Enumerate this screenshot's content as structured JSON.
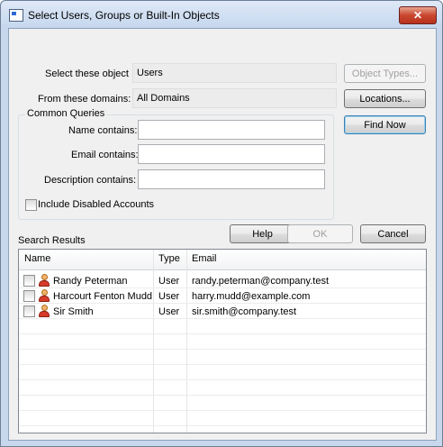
{
  "window": {
    "title": "Select Users, Groups or Built-In Objects",
    "close_glyph": "✕"
  },
  "object_type": {
    "label": "Select these object",
    "value": "Users",
    "button": "Object Types..."
  },
  "domains": {
    "label": "From these domains:",
    "value": "All Domains",
    "button": "Locations..."
  },
  "common_queries": {
    "title": "Common Queries",
    "name_label": "Name contains:",
    "name_value": "",
    "email_label": "Email contains:",
    "email_value": "",
    "description_label": "Description contains:",
    "description_value": "",
    "include_disabled_label": "Include Disabled Accounts",
    "include_disabled_checked": false
  },
  "buttons": {
    "find_now": "Find Now",
    "help": "Help",
    "ok": "OK",
    "cancel": "Cancel"
  },
  "results": {
    "label": "Search Results",
    "columns": [
      "Name",
      "Type",
      "Email"
    ],
    "rows": [
      {
        "name": "Randy Peterman",
        "type": "User",
        "email": "randy.peterman@company.test",
        "icon": "user-icon"
      },
      {
        "name": "Harcourt Fenton Mudd",
        "type": "User",
        "email": "harry.mudd@example.com",
        "icon": "user-icon"
      },
      {
        "name": "Sir Smith",
        "type": "User",
        "email": "sir.smith@company.test",
        "icon": "user-icon"
      }
    ]
  },
  "colors": {
    "title_gradient_top": "#dfe9f7",
    "close_button": "#c9472f",
    "dialog_background": "#f0f0f0",
    "default_button_border": "#3c7fb1"
  }
}
